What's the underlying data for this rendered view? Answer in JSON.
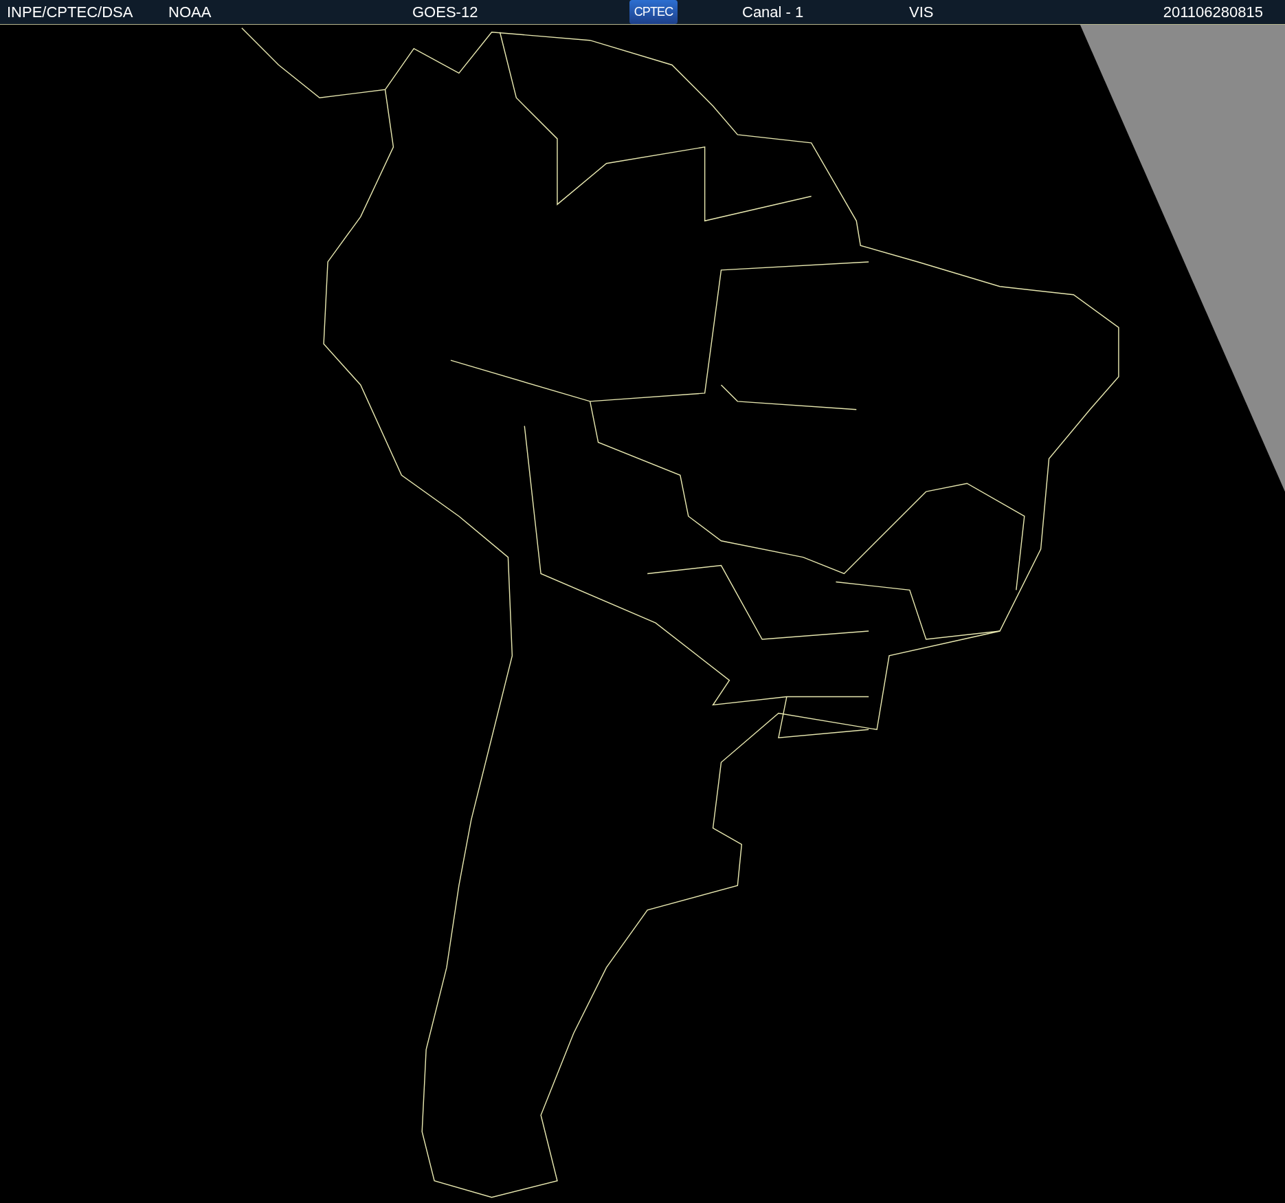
{
  "header": {
    "source": "INPE/CPTEC/DSA",
    "agency": "NOAA",
    "satellite": "GOES-12",
    "logo": "CPTEC",
    "channel": "Canal - 1",
    "band": "VIS",
    "timestamp": "201106280815"
  }
}
